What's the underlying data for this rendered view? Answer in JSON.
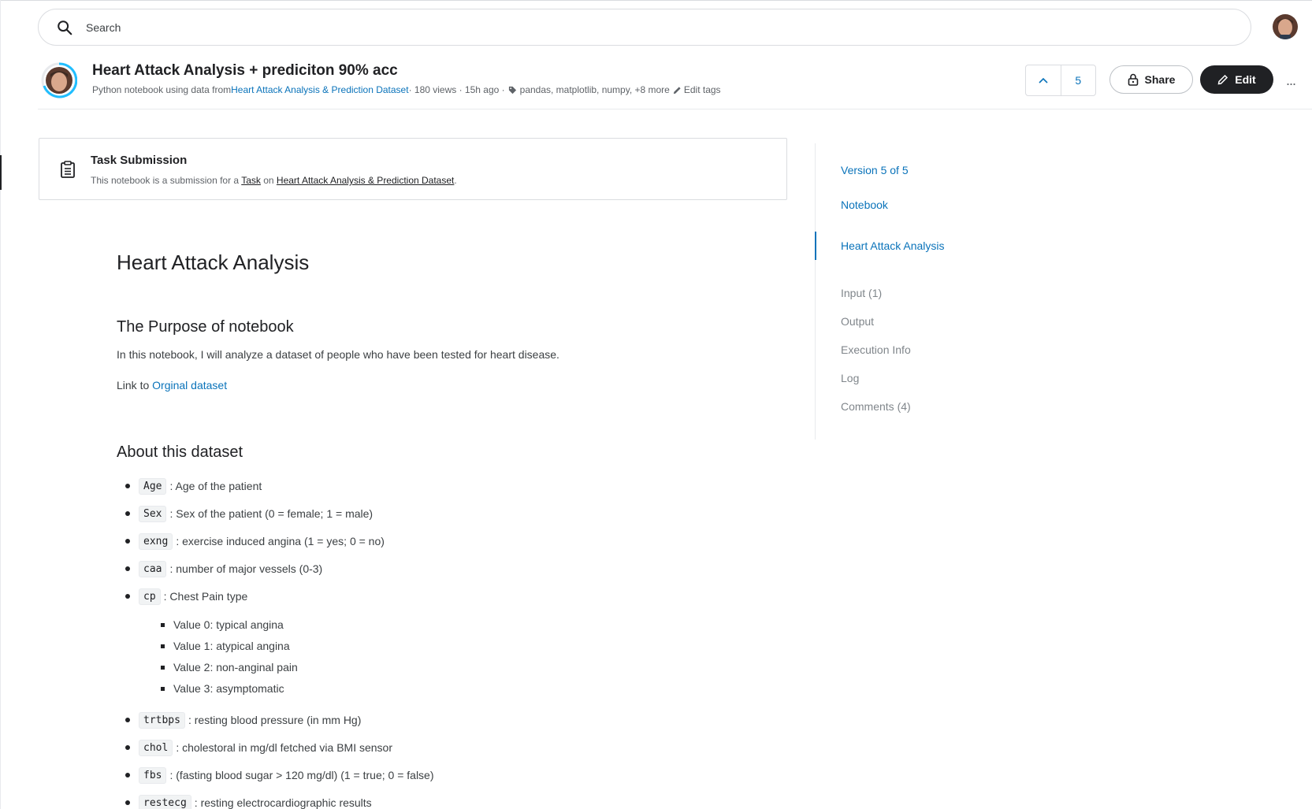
{
  "search": {
    "placeholder": "Search"
  },
  "header": {
    "title": "Heart Attack Analysis + prediciton 90% acc",
    "meta_prefix": "Python notebook using data from ",
    "dataset_link": "Heart Attack Analysis & Prediction Dataset",
    "views": " · 180 views · 15h ago · ",
    "tags": "pandas, matplotlib, numpy, +8 more",
    "edit_tags": "Edit tags",
    "vote_count": "5",
    "share_label": "Share",
    "edit_label": "Edit",
    "more_label": "..."
  },
  "task": {
    "title": "Task Submission",
    "desc_prefix": "This notebook is a submission for a ",
    "task_link": "Task",
    "desc_mid": " on ",
    "dataset_link": "Heart Attack Analysis & Prediction Dataset",
    "desc_suffix": "."
  },
  "notebook": {
    "h1": "Heart Attack Analysis",
    "h2_purpose": "The Purpose of notebook",
    "purpose_text": "In this notebook, I will analyze a dataset of people who have been tested for heart disease.",
    "link_prefix": "Link to ",
    "link_text": "Orginal dataset",
    "h2_about": "About this dataset",
    "items": [
      {
        "code": "Age",
        "text": ": Age of the patient"
      },
      {
        "code": "Sex",
        "text": ": Sex of the patient (0 = female; 1 = male)"
      },
      {
        "code": "exng",
        "text": ": exercise induced angina (1 = yes; 0 = no)"
      },
      {
        "code": "caa",
        "text": ": number of major vessels (0-3)"
      },
      {
        "code": "cp",
        "text": ": Chest Pain type"
      },
      {
        "code": "trtbps",
        "text": ": resting blood pressure (in mm Hg)"
      },
      {
        "code": "chol",
        "text": ": cholestoral in mg/dl fetched via BMI sensor"
      },
      {
        "code": "fbs",
        "text": ": (fasting blood sugar > 120 mg/dl) (1 = true; 0 = false)"
      },
      {
        "code": "restecg",
        "text": ": resting electrocardiographic results"
      }
    ],
    "cp_values": [
      "Value 0: typical angina",
      "Value 1: atypical angina",
      "Value 2: non-anginal pain",
      "Value 3: asymptomatic"
    ]
  },
  "sidebar": {
    "version": "Version 5 of 5",
    "notebook": "Notebook",
    "section": "Heart Attack Analysis",
    "input": "Input (1)",
    "output": "Output",
    "execution": "Execution Info",
    "log": "Log",
    "comments": "Comments (4)"
  },
  "colors": {
    "accent": "#0a73ba",
    "dark": "#202124"
  }
}
